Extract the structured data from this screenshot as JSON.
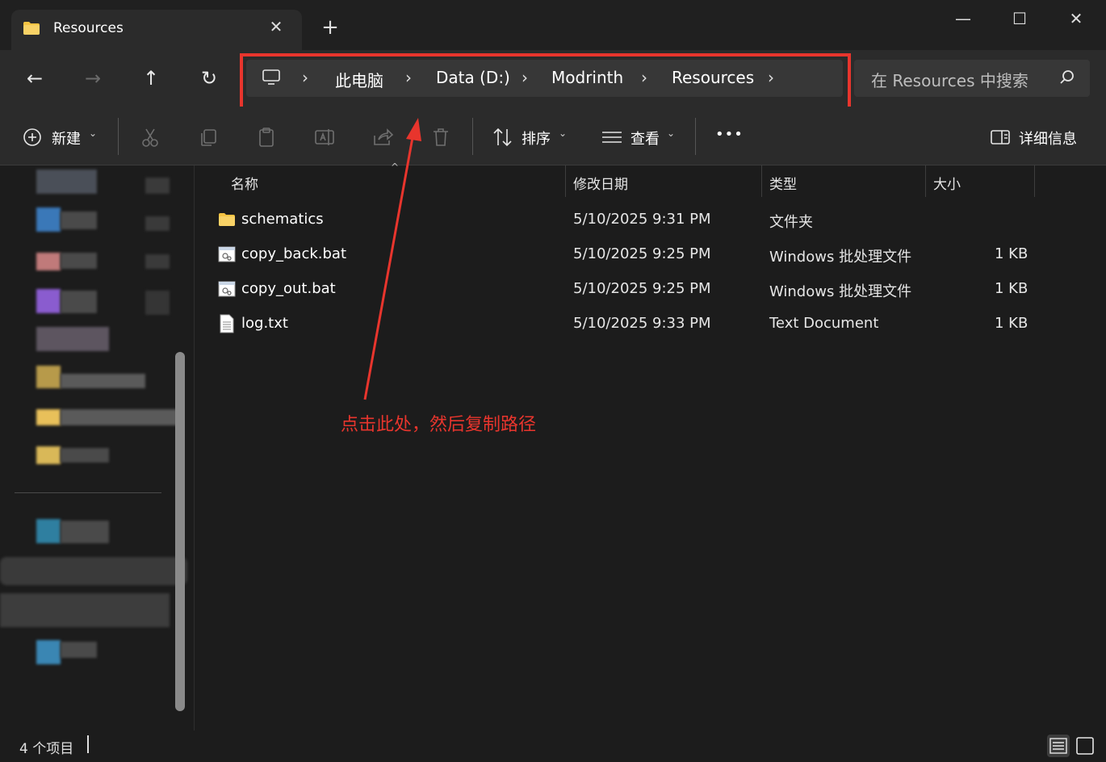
{
  "window": {
    "tab_title": "Resources",
    "new_tab_label": "+",
    "minimize_label": "—",
    "maximize_label": "☐",
    "close_label": "✕"
  },
  "nav": {
    "back_label": "←",
    "forward_label": "→",
    "up_label": "↑",
    "refresh_label": "↻"
  },
  "breadcrumb": {
    "items": [
      "此电脑",
      "Data (D:)",
      "Modrinth",
      "Resources"
    ],
    "separator": "›"
  },
  "search": {
    "placeholder": "在 Resources 中搜索"
  },
  "commandbar": {
    "new_label": "新建",
    "sort_label": "排序",
    "view_label": "查看",
    "more_label": "•••",
    "details_label": "详细信息"
  },
  "columns": {
    "name": "名称",
    "modified": "修改日期",
    "type": "类型",
    "size": "大小"
  },
  "files": [
    {
      "name": "schematics",
      "modified": "5/10/2025 9:31 PM",
      "type": "文件夹",
      "size": "",
      "icon": "folder-icon"
    },
    {
      "name": "copy_back.bat",
      "modified": "5/10/2025 9:25 PM",
      "type": "Windows 批处理文件",
      "size": "1 KB",
      "icon": "batch-file-icon"
    },
    {
      "name": "copy_out.bat",
      "modified": "5/10/2025 9:25 PM",
      "type": "Windows 批处理文件",
      "size": "1 KB",
      "icon": "batch-file-icon"
    },
    {
      "name": "log.txt",
      "modified": "5/10/2025 9:33 PM",
      "type": "Text Document",
      "size": "1 KB",
      "icon": "text-file-icon"
    }
  ],
  "annotation": {
    "text": "点击此处，然后复制路径",
    "color": "#e8352d"
  },
  "status": {
    "item_count": "4 个项目"
  },
  "colors": {
    "accent_red": "#e8352d",
    "folder_yellow": "#f5c342",
    "background": "#1c1c1c",
    "panel": "#2b2b2b"
  }
}
